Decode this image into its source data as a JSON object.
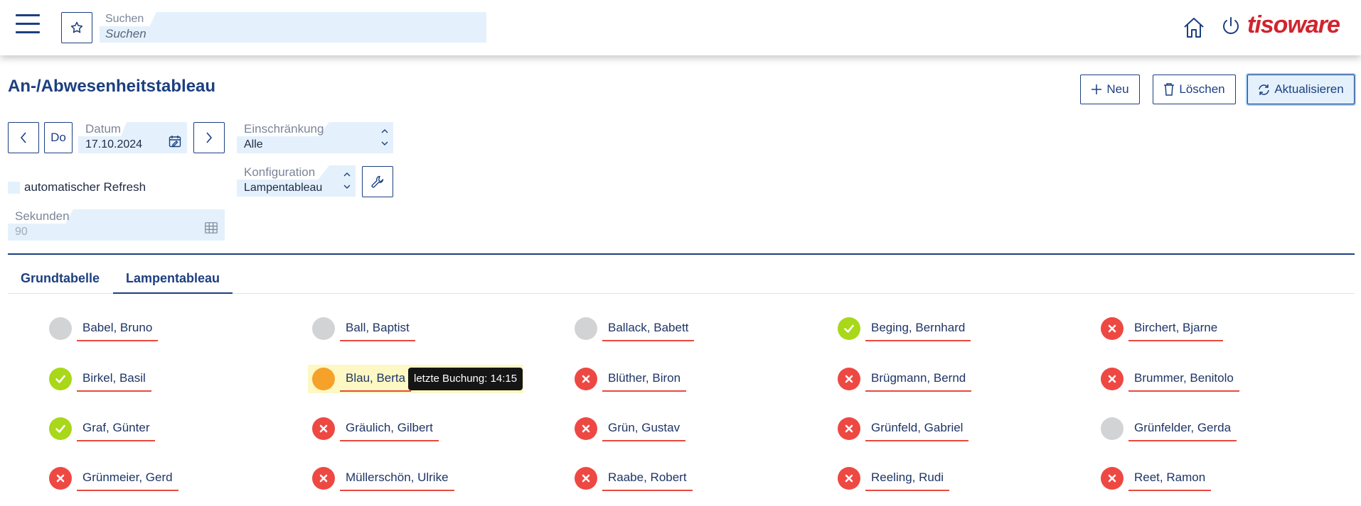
{
  "header": {
    "search_label": "Suchen",
    "search_placeholder": "Suchen",
    "logo_text": "tisoware",
    "icons": [
      "menu-icon",
      "star-icon",
      "home-icon",
      "power-icon"
    ]
  },
  "page": {
    "title": "An-/Abwesenheitstableau",
    "actions": {
      "new": "Neu",
      "delete": "Löschen",
      "refresh": "Aktualisieren"
    }
  },
  "controls": {
    "weekday": "Do",
    "date_label": "Datum",
    "date_value": "17.10.2024",
    "restriction_label": "Einschränkung",
    "restriction_value": "Alle",
    "config_label": "Konfiguration",
    "config_value": "Lampentableau",
    "auto_refresh_label": "automatischer Refresh",
    "auto_refresh_checked": false,
    "seconds_label": "Sekunden",
    "seconds_value": "90"
  },
  "tabs": [
    {
      "label": "Grundtabelle",
      "active": false
    },
    {
      "label": "Lampentableau",
      "active": true
    }
  ],
  "colors": {
    "grey": "#d2d3d4",
    "green": "#a9d719",
    "red": "#ee4843",
    "orange": "#f5a12a",
    "accent": "#1c3f80",
    "brand": "#d1242f"
  },
  "people": [
    {
      "name": "Babel, Bruno",
      "status": "grey"
    },
    {
      "name": "Ball, Baptist",
      "status": "grey"
    },
    {
      "name": "Ballack, Babett",
      "status": "grey"
    },
    {
      "name": "Beging, Bernhard",
      "status": "green"
    },
    {
      "name": "Birchert, Bjarne",
      "status": "red"
    },
    {
      "name": "Birkel, Basil",
      "status": "green"
    },
    {
      "name": "Blau, Berta",
      "status": "orange"
    },
    {
      "name": "Blüther, Biron",
      "status": "red"
    },
    {
      "name": "Brügmann, Bernd",
      "status": "red"
    },
    {
      "name": "Brummer, Benitolo",
      "status": "red"
    },
    {
      "name": "Graf, Günter",
      "status": "green"
    },
    {
      "name": "Gräulich, Gilbert",
      "status": "red"
    },
    {
      "name": "Grün, Gustav",
      "status": "red"
    },
    {
      "name": "Grünfeld, Gabriel",
      "status": "red"
    },
    {
      "name": "Grünfelder, Gerda",
      "status": "grey"
    },
    {
      "name": "Grünmeier, Gerd",
      "status": "red"
    },
    {
      "name": "Müllerschön, Ulrike",
      "status": "red"
    },
    {
      "name": "Raabe, Robert",
      "status": "red"
    },
    {
      "name": "Reeling, Rudi",
      "status": "red"
    },
    {
      "name": "Reet, Ramon",
      "status": "red"
    }
  ],
  "tooltip": "letzte Buchung: 14:15"
}
